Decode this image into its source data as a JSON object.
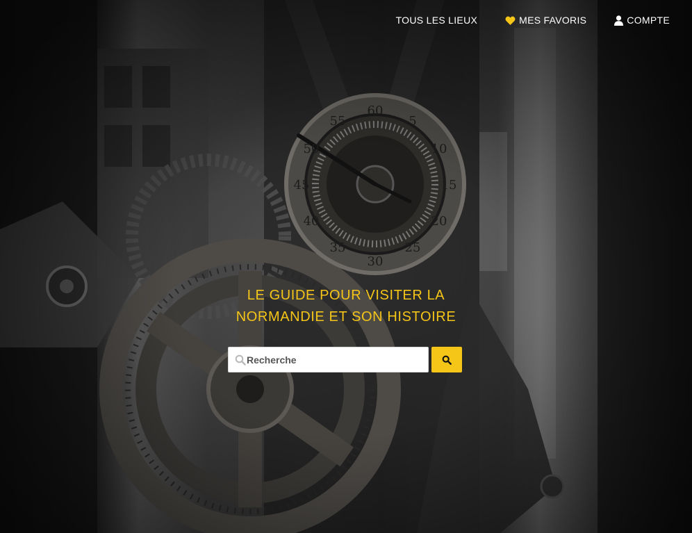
{
  "nav": {
    "items": [
      {
        "label": "TOUS LES LIEUX",
        "icon": ""
      },
      {
        "label": "MES FAVORIS",
        "icon": "heart-icon"
      },
      {
        "label": "COMPTE",
        "icon": "user-icon"
      }
    ]
  },
  "hero": {
    "tagline_line1": "LE GUIDE POUR VISITER LA",
    "tagline_line2": "NORMANDIE ET SON HISTOIRE",
    "dial_numbers": [
      "60",
      "5",
      "10",
      "15",
      "20",
      "25",
      "30",
      "35",
      "40",
      "45",
      "50",
      "55"
    ]
  },
  "search": {
    "placeholder": "Recherche",
    "button_icon": "search-icon"
  },
  "colors": {
    "accent": "#f5c518",
    "nav_text": "#ffffff",
    "heart": "#f5c518"
  }
}
